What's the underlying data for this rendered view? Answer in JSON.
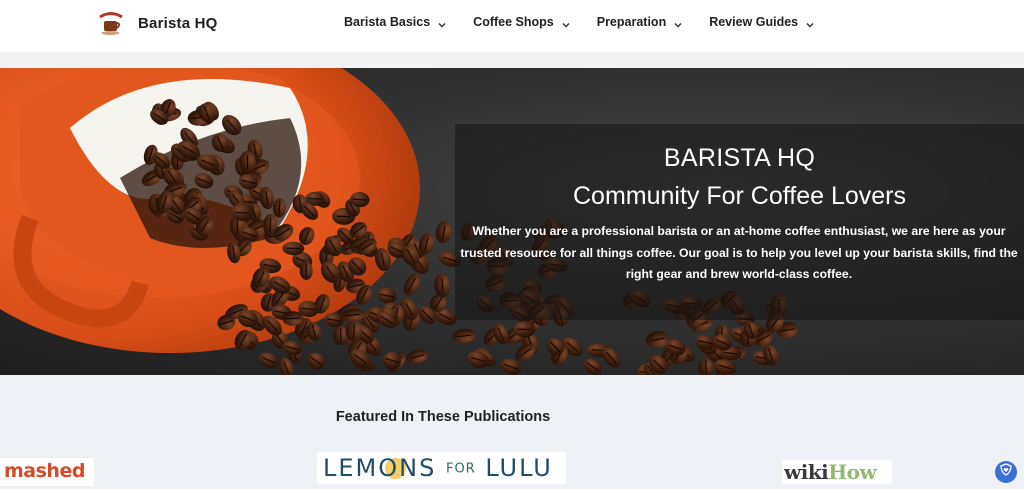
{
  "brand": {
    "name": "Barista HQ",
    "logo_icon": "barista-cup-logo"
  },
  "nav": {
    "items": [
      {
        "label": "Barista Basics",
        "icon": "chevron-down-icon"
      },
      {
        "label": "Coffee Shops",
        "icon": "chevron-down-icon"
      },
      {
        "label": "Preparation",
        "icon": "chevron-down-icon"
      },
      {
        "label": "Review Guides",
        "icon": "chevron-down-icon"
      }
    ]
  },
  "hero": {
    "title": "BARISTA HQ",
    "subtitle": "Community For Coffee Lovers",
    "description": "Whether you are a professional barista or an at-home coffee enthusiast, we are here as your trusted resource for all things coffee. Our goal is to help you level up your barista skills, find the right gear and brew world-class coffee.",
    "image": "orange-cup-spilling-coffee-beans"
  },
  "featured": {
    "title": "Featured In These Publications",
    "publications": [
      {
        "name": "mashed"
      },
      {
        "name_left": "LEMONS",
        "name_mid": "FOR",
        "name_right": "LULU"
      },
      {
        "name_left": "wiki",
        "name_right": "How"
      }
    ]
  },
  "colors": {
    "mashed": "#d64a2a",
    "lemons": "#214d6b",
    "wikihow_green": "#93b874",
    "privacy": "#3d6fd8"
  },
  "privacy_button": {
    "icon": "shield-heart-icon"
  }
}
